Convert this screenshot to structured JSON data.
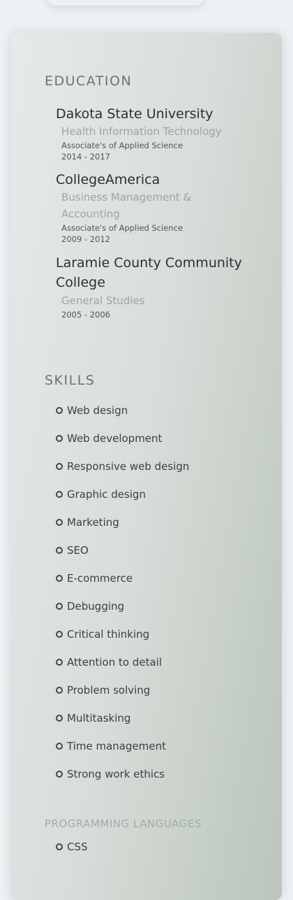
{
  "education": {
    "title": "EDUCATION",
    "items": [
      {
        "school": "Dakota State University",
        "degree": "Health Information Technology",
        "credential": "Associate's of Applied Science",
        "dates": "2014 - 2017"
      },
      {
        "school": "CollegeAmerica",
        "degree": "Business Management & Accounting",
        "credential": "Associate's of Applied Science",
        "dates": "2009 - 2012"
      },
      {
        "school": "Laramie County Community College",
        "degree": "General Studies",
        "credential": "",
        "dates": "2005 - 2006"
      }
    ]
  },
  "skills": {
    "title": "SKILLS",
    "items": [
      "Web design",
      "Web development",
      "Responsive web design",
      "Graphic design",
      "Marketing",
      "SEO",
      "E-commerce",
      "Debugging",
      "Critical thinking",
      "Attention to detail",
      "Problem solving",
      "Multitasking",
      "Time management",
      "Strong work ethics"
    ]
  },
  "programming": {
    "title": "PROGRAMMING LANGUAGES",
    "items": [
      "CSS"
    ]
  }
}
